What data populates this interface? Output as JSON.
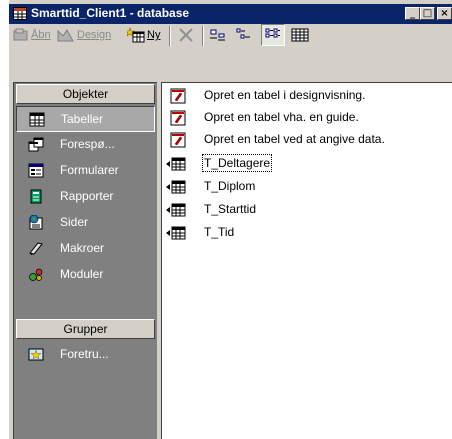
{
  "window": {
    "title": "Smarttid_Client1 - database",
    "min_glyph": "_",
    "max_glyph": "□",
    "close_glyph": "×"
  },
  "toolbar": {
    "open_label": "Åbn",
    "design_label": "Design",
    "new_label": "Ny"
  },
  "sidebar": {
    "objects_header": "Objekter",
    "groups_header": "Grupper",
    "items": [
      {
        "label": "Tabeller",
        "icon": "table-icon"
      },
      {
        "label": "Forespø...",
        "icon": "query-icon"
      },
      {
        "label": "Formularer",
        "icon": "form-icon"
      },
      {
        "label": "Rapporter",
        "icon": "report-icon"
      },
      {
        "label": "Sider",
        "icon": "page-icon"
      },
      {
        "label": "Makroer",
        "icon": "macro-icon"
      },
      {
        "label": "Moduler",
        "icon": "module-icon"
      }
    ],
    "groups": [
      {
        "label": "Foretru...",
        "icon": "favorites-icon"
      }
    ]
  },
  "list": {
    "items": [
      {
        "label": "Opret en tabel i designvisning.",
        "type": "wizard"
      },
      {
        "label": "Opret en tabel vha. en guide.",
        "type": "wizard"
      },
      {
        "label": "Opret en tabel ved at angive data.",
        "type": "wizard"
      },
      {
        "label": "T_Deltagere",
        "type": "table"
      },
      {
        "label": "T_Diplom",
        "type": "table"
      },
      {
        "label": "T_Starttid",
        "type": "table"
      },
      {
        "label": "T_Tid",
        "type": "table"
      }
    ]
  },
  "colors": {
    "titlebar": "#0a246a",
    "face": "#d4d0c8",
    "sidebar_bg": "#808080",
    "selected": "#a8a8a8"
  }
}
